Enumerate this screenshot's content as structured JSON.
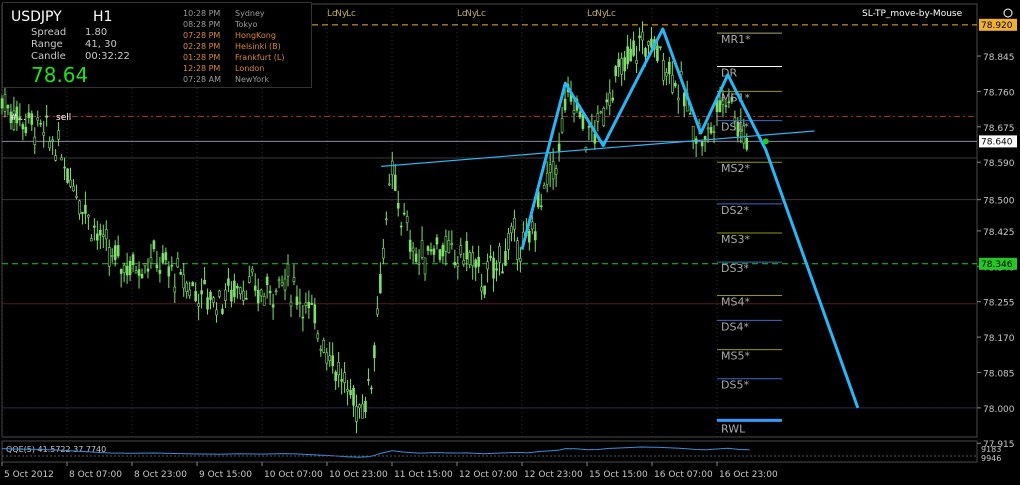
{
  "header": {
    "symbol": "USDJPY",
    "timeframe": "H1",
    "spread_label": "Spread",
    "spread_value": "1.80",
    "range_label": "Range",
    "range_value": "41, 30",
    "candle_label": "Candle",
    "candle_value": "00:32:22",
    "big_price": "78.64",
    "indicator_letters": [
      "S",
      "o",
      "c",
      "R"
    ],
    "letter_colors": [
      "#1e90ff",
      "#1e90ff",
      "#ff3b3b",
      "#ff3b3b"
    ],
    "ea_label": "SL-TP_move-by-Mouse",
    "smiley_icon": "smiley-icon",
    "sell_label": "sell",
    "trade_marker": "#..."
  },
  "sessions": [
    {
      "time": "10:28 PM",
      "name": "Sydney",
      "open": false
    },
    {
      "time": "08:28 PM",
      "name": "Tokyo",
      "open": false
    },
    {
      "time": "07:28 PM",
      "name": "HongKong",
      "open": true
    },
    {
      "time": "02:28 PM",
      "name": "Helsinki (B)",
      "open": true
    },
    {
      "time": "01:28 PM",
      "name": "Frankfurt (L)",
      "open": true
    },
    {
      "time": "12:28 PM",
      "name": "London",
      "open": true
    },
    {
      "time": "07:28 AM",
      "name": "NewYork",
      "open": false
    }
  ],
  "session_markers": [
    {
      "label": "c",
      "x": 6
    },
    {
      "label": "Lo",
      "x": 12
    },
    {
      "label": "Ny",
      "x": 13.5
    },
    {
      "label": "Lc",
      "x": 15.5
    },
    {
      "label": "Lo",
      "x": 36
    },
    {
      "label": "Ny",
      "x": 37.5
    },
    {
      "label": "Lc",
      "x": 39.5
    },
    {
      "label": "Lo",
      "x": 60
    },
    {
      "label": "Ny",
      "x": 61.5
    },
    {
      "label": "Lc",
      "x": 63.5
    },
    {
      "label": "Lo",
      "x": 84
    },
    {
      "label": "Ny",
      "x": 85.5
    },
    {
      "label": "Lc",
      "x": 87.5
    },
    {
      "label": "Lo",
      "x": 108
    },
    {
      "label": "Ny",
      "x": 109.5
    },
    {
      "label": "Lc",
      "x": 111.5
    }
  ],
  "colors": {
    "background": "#000000",
    "candle": "#7ee06a",
    "pattern": "#29b6f6",
    "grid": "#2a3a2a",
    "price_tag_bg": "#ffffff",
    "price_tag_fg": "#000000",
    "gold": "#f0b030",
    "green": "#23c823",
    "maroon": "#8b0000",
    "axis_text": "#c8c8c8"
  },
  "chart_data": {
    "type": "candlestick",
    "symbol": "USDJPY",
    "timeframe": "H1",
    "ylim": [
      77.93,
      78.97
    ],
    "y_ticks": [
      77.915,
      78.0,
      78.085,
      78.17,
      78.255,
      78.34,
      78.425,
      78.5,
      78.59,
      78.675,
      78.76,
      78.845
    ],
    "tick_labels_y": [
      "77.915",
      "78.000",
      "78.085",
      "78.170",
      "78.255",
      "78.340",
      "78.425",
      "78.500",
      "78.590",
      "78.675",
      "78.760",
      "78.845"
    ],
    "x_labels": [
      {
        "x": 0,
        "label": "5 Oct 2012"
      },
      {
        "x": 12,
        "label": "8 Oct 07:00"
      },
      {
        "x": 24,
        "label": "8 Oct 23:00"
      },
      {
        "x": 36,
        "label": "9 Oct 15:00"
      },
      {
        "x": 48,
        "label": "10 Oct 07:00"
      },
      {
        "x": 60,
        "label": "10 Oct 23:00"
      },
      {
        "x": 72,
        "label": "11 Oct 15:00"
      },
      {
        "x": 84,
        "label": "12 Oct 07:00"
      },
      {
        "x": 96,
        "label": "12 Oct 23:00"
      },
      {
        "x": 108,
        "label": "15 Oct 15:00"
      },
      {
        "x": 120,
        "label": "16 Oct 07:00"
      },
      {
        "x": 132,
        "label": "16 Oct 23:00"
      }
    ],
    "x_range": [
      0,
      180
    ],
    "candle_path": [
      [
        0,
        78.74
      ],
      [
        3,
        78.7
      ],
      [
        6,
        78.68
      ],
      [
        10,
        78.63
      ],
      [
        13,
        78.55
      ],
      [
        16,
        78.46
      ],
      [
        20,
        78.36
      ],
      [
        24,
        78.34
      ],
      [
        28,
        78.36
      ],
      [
        32,
        78.32
      ],
      [
        36,
        78.28
      ],
      [
        40,
        78.26
      ],
      [
        44,
        78.3
      ],
      [
        48,
        78.27
      ],
      [
        52,
        78.31
      ],
      [
        55,
        78.27
      ],
      [
        58,
        78.2
      ],
      [
        61,
        78.12
      ],
      [
        64,
        78.03
      ],
      [
        66,
        78.0
      ],
      [
        68,
        78.05
      ],
      [
        70,
        78.34
      ],
      [
        72,
        78.56
      ],
      [
        74,
        78.45
      ],
      [
        77,
        78.35
      ],
      [
        80,
        78.4
      ],
      [
        83,
        78.36
      ],
      [
        86,
        78.37
      ],
      [
        89,
        78.3
      ],
      [
        92,
        78.36
      ],
      [
        95,
        78.41
      ],
      [
        97,
        78.38
      ],
      [
        99,
        78.48
      ],
      [
        101,
        78.55
      ],
      [
        103,
        78.62
      ],
      [
        104,
        78.74
      ],
      [
        106,
        78.73
      ],
      [
        108,
        78.65
      ],
      [
        110,
        78.67
      ],
      [
        112,
        78.76
      ],
      [
        115,
        78.82
      ],
      [
        118,
        78.88
      ],
      [
        121,
        78.86
      ],
      [
        124,
        78.8
      ],
      [
        126,
        78.74
      ],
      [
        128,
        78.67
      ],
      [
        130,
        78.64
      ],
      [
        132,
        78.71
      ],
      [
        134,
        78.77
      ],
      [
        136,
        78.68
      ],
      [
        138,
        78.64
      ]
    ],
    "pattern_line": [
      [
        96,
        78.38
      ],
      [
        104,
        78.78
      ],
      [
        111,
        78.63
      ],
      [
        122,
        78.91
      ],
      [
        129,
        78.66
      ],
      [
        134,
        78.8
      ],
      [
        141,
        78.62
      ],
      [
        158,
        78.0
      ]
    ],
    "neckline": [
      [
        70,
        78.58
      ],
      [
        150,
        78.665
      ]
    ],
    "projection_dot": {
      "x": 141,
      "y": 78.64,
      "color": "#23c823"
    },
    "horizontal_lines": [
      {
        "y": 78.92,
        "color": "#f0b030",
        "style": "dash",
        "label": "78.920"
      },
      {
        "y": 78.346,
        "color": "#23c823",
        "style": "dash",
        "label": "78.346"
      },
      {
        "y": 78.64,
        "color": "#8888aa",
        "style": "solid",
        "label": "78.640"
      },
      {
        "y": 78.7,
        "color": "#b03030",
        "style": "dashdot",
        "label": ""
      },
      {
        "y": 78.6,
        "color": "#3a3a3a",
        "style": "solid",
        "label": ""
      },
      {
        "y": 78.5,
        "color": "#3a3a3a",
        "style": "solid",
        "label": ""
      },
      {
        "y": 78.25,
        "color": "#5a1a1a",
        "style": "solid",
        "label": ""
      },
      {
        "y": 78.0,
        "color": "#2a2a5a",
        "style": "solid",
        "label": ""
      }
    ],
    "pivot_levels": [
      {
        "name": "MR1*",
        "y": 78.9,
        "color": "#aaaa66"
      },
      {
        "name": "DR",
        "y": 78.82,
        "color": "#ffffff"
      },
      {
        "name": "MS1*",
        "y": 78.76,
        "color": "#999900"
      },
      {
        "name": "DS1*",
        "y": 78.69,
        "color": "#3a6ad0"
      },
      {
        "name": "MS2*",
        "y": 78.59,
        "color": "#999900"
      },
      {
        "name": "DS2*",
        "y": 78.49,
        "color": "#3a6ad0"
      },
      {
        "name": "MS3*",
        "y": 78.42,
        "color": "#999900"
      },
      {
        "name": "DS3*",
        "y": 78.35,
        "color": "#3a6ad0"
      },
      {
        "name": "MS4*",
        "y": 78.27,
        "color": "#999900"
      },
      {
        "name": "DS4*",
        "y": 78.21,
        "color": "#3a6ad0"
      },
      {
        "name": "MS5*",
        "y": 78.14,
        "color": "#999900"
      },
      {
        "name": "DS5*",
        "y": 78.07,
        "color": "#3a6ad0"
      },
      {
        "name": "RWL",
        "y": 77.97,
        "color": "#3399ff"
      }
    ],
    "indicator": {
      "name": "QQE(5)",
      "values_label": "QQE(5) 41.5722 37.7740",
      "right_ticks": [
        "9183",
        "9946"
      ]
    }
  }
}
